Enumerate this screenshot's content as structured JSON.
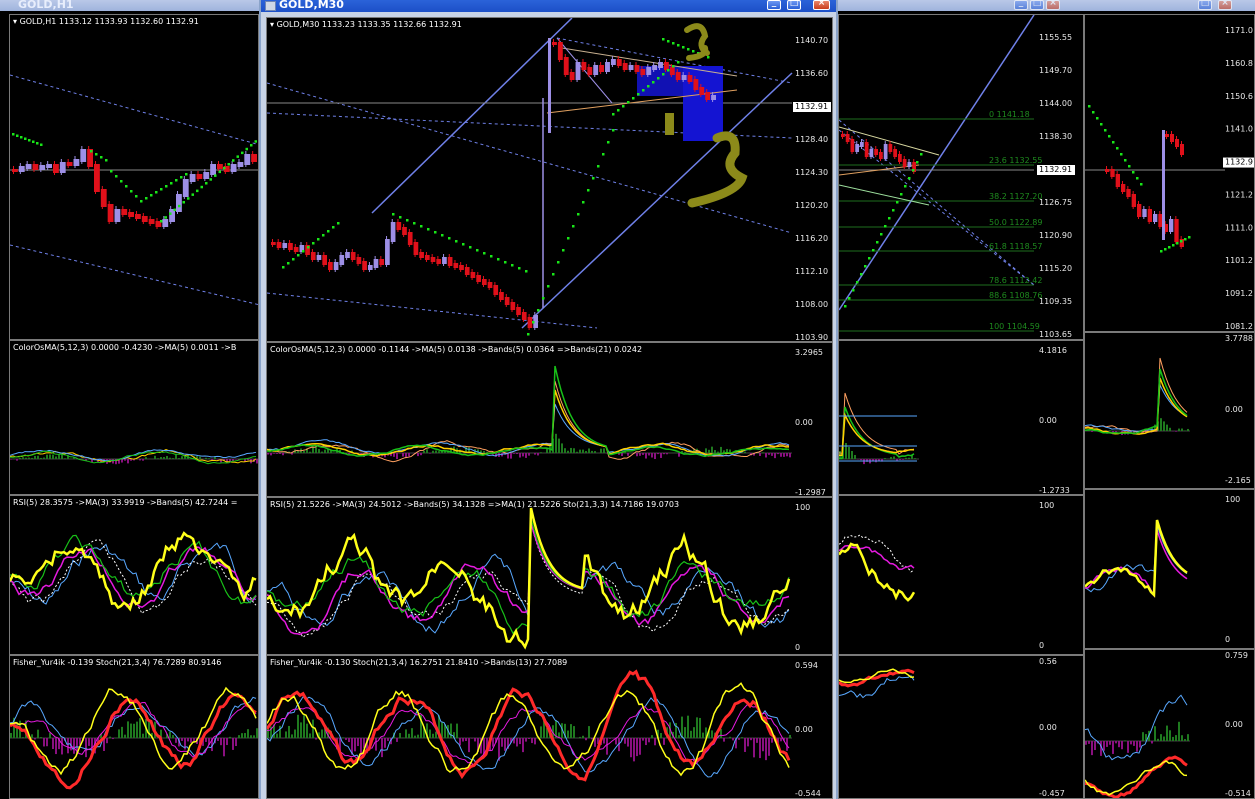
{
  "windows": {
    "h1": {
      "title": "GOLD,H1",
      "header": "GOLD,H1  1133.12 1133.93 1132.60 1132.91",
      "osma": "ColorOsMA(5,12,3) 0.0000 -0.4230  ->MA(5) 0.0011  ->B",
      "rsi": "RSI(5) 28.3575  ->MA(3) 33.9919  ->Bands(5) 42.7244  =",
      "fisher": "Fisher_Yur4ik -0.139  Stoch(21,3,4) 76.7289 80.9146"
    },
    "m30": {
      "title": "GOLD,M30",
      "header": "GOLD,M30  1133.23 1133.35 1132.66 1132.91",
      "price_scale": [
        "1140.70",
        "1136.60",
        "1132.91",
        "1128.40",
        "1124.30",
        "1120.20",
        "1116.20",
        "1112.10",
        "1108.00",
        "1103.90"
      ],
      "osma": "ColorOsMA(5,12,3) 0.0000 -0.1144  ->MA(5) 0.0138  ->Bands(5) 0.0364  =>Bands(21) 0.0242",
      "osma_scale": [
        "3.2965",
        "0.00",
        "-1.2987"
      ],
      "rsi": "RSI(5) 21.5226  ->MA(3) 24.5012  ->Bands(5) 34.1328  =>MA(1) 21.5226   Sto(21,3,3) 14.7186 19.0703",
      "rsi_scale": [
        "100",
        "0"
      ],
      "fisher": "Fisher_Yur4ik -0.130  Stoch(21,3,4) 16.2751 21.8410  ->Bands(13) 27.7089",
      "fisher_scale": [
        "0.594",
        "0.00",
        "-0.544"
      ]
    },
    "third": {
      "price_scale": [
        "1155.55",
        "1149.70",
        "1144.00",
        "1138.30",
        "1132.91",
        "1126.75",
        "1120.90",
        "1115.20",
        "1109.35",
        "1103.65"
      ],
      "fib_labels": [
        "0 1141.18",
        "23.6 1132.55",
        "38.2 1127.20",
        "50.0 1122.89",
        "61.8 1118.57",
        "78.6 1112.42",
        "88.6 1108.76",
        "100 1104.59"
      ],
      "osma_scale": [
        "4.1816",
        "0.00",
        "-1.2733"
      ],
      "rsi_scale": [
        "100",
        "0"
      ],
      "fisher_scale": [
        "0.56",
        "0.00",
        "-0.457"
      ]
    },
    "fourth": {
      "price_scale": [
        "1171.0",
        "1160.8",
        "1150.6",
        "1141.0",
        "1132.91",
        "1121.2",
        "1111.0",
        "1101.2",
        "1091.2",
        "1081.2"
      ],
      "osma_scale": [
        "3.7788",
        "0.00",
        "-2.165"
      ],
      "rsi_scale": [
        "100",
        "0"
      ],
      "fisher_scale": [
        "0.759",
        "0.00",
        "-0.514"
      ]
    }
  },
  "colors": {
    "bull": "#9d8fe6",
    "bear": "#e0101a",
    "sar": "#19e619",
    "channel": "#6f80e8",
    "rsi": "#ffff1a",
    "ma": "#e51adf",
    "band": "#58a8ff",
    "hist_pos": "#1f7a1f",
    "hist_neg": "#8a1080",
    "annotation": "#8c8a1a",
    "overlay": "#1414d2"
  },
  "icons": [
    "window-icon",
    "minimize-icon",
    "maximize-icon",
    "close-icon",
    "dropdown-triangle-icon"
  ]
}
